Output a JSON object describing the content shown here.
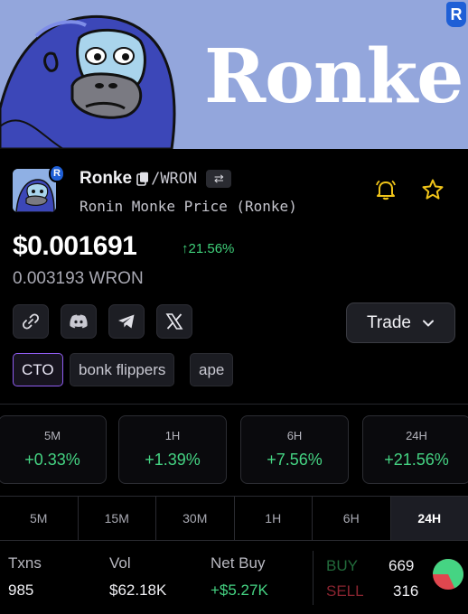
{
  "banner": {
    "title": "Ronke",
    "badge": "R"
  },
  "token": {
    "name": "Ronke",
    "pair": "/WRON",
    "swap_glyph": "⇄",
    "subtitle": "Ronin Monke Price (Ronke)",
    "price_usd": "$0.001691",
    "change_glyph": "↑",
    "change_pct": "21.56%",
    "price_wron": "0.003193 WRON",
    "avatar_badge": "R"
  },
  "actions": {
    "trade_label": "Trade",
    "icons": [
      "link-icon",
      "discord-icon",
      "telegram-icon",
      "x-icon",
      "bell-icon",
      "star-icon"
    ]
  },
  "tags": [
    "CTO",
    "bonk flippers",
    "ape"
  ],
  "stats": [
    {
      "label": "5M",
      "value": "+0.33%"
    },
    {
      "label": "1H",
      "value": "+1.39%"
    },
    {
      "label": "6H",
      "value": "+7.56%"
    },
    {
      "label": "24H",
      "value": "+21.56%"
    }
  ],
  "timeframes": [
    "5M",
    "15M",
    "30M",
    "1H",
    "6H",
    "24H"
  ],
  "active_timeframe": "24H",
  "metrics": {
    "txns_label": "Txns",
    "txns_value": "985",
    "vol_label": "Vol",
    "vol_value": "$62.18K",
    "netbuy_label": "Net Buy",
    "netbuy_value": "+$5.27K",
    "buy_label": "BUY",
    "buy_value": "669",
    "sell_label": "SELL",
    "sell_value": "316",
    "buy_share": 0.68
  },
  "colors": {
    "banner_bg": "#93a6dc",
    "positive": "#45d483",
    "negative": "#e0474f",
    "accent_purple": "#8f5cf0",
    "ronin_blue": "#1f5fd6"
  }
}
